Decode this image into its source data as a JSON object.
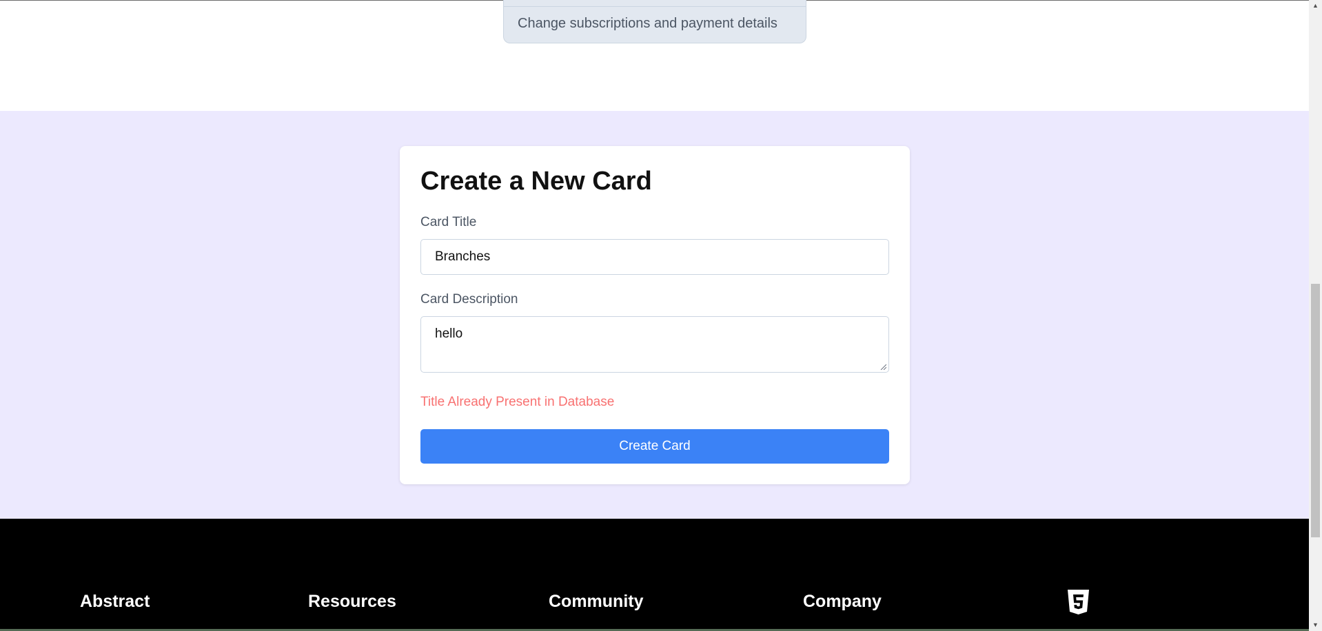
{
  "top_card": {
    "text": "Change subscriptions and payment details"
  },
  "form": {
    "heading": "Create a New Card",
    "title_label": "Card Title",
    "title_value": "Branches",
    "description_label": "Card Description",
    "description_value": "hello",
    "error_message": "Title Already Present in Database",
    "submit_label": "Create Card"
  },
  "footer": {
    "headings": [
      "Abstract",
      "Resources",
      "Community",
      "Company"
    ],
    "logo_icon": "html5-icon"
  },
  "scrollbar": {
    "up_arrow": "▲",
    "down_arrow": "▼"
  },
  "colors": {
    "accent": "#3b82f6",
    "error": "#f87171",
    "form_background": "#ece9fe",
    "footer_background": "#000000"
  }
}
